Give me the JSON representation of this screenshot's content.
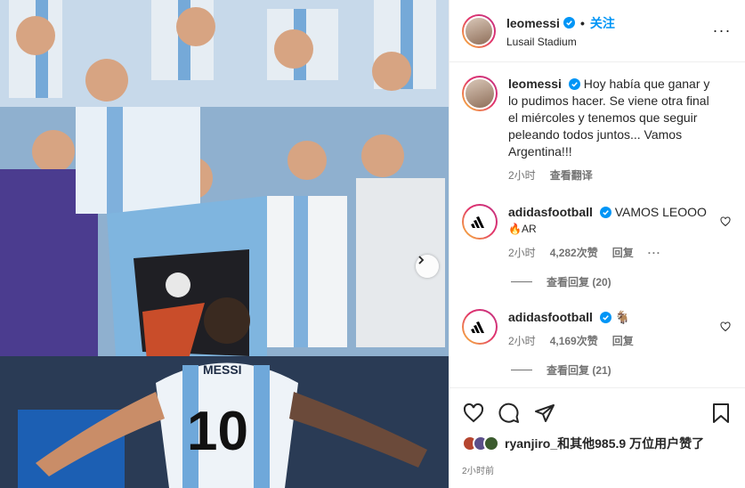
{
  "post": {
    "username": "leomessi",
    "follow_label": "关注",
    "location": "Lusail Stadium",
    "photo_alt_jersey_name": "MESSI",
    "photo_alt_jersey_number": "10"
  },
  "caption": {
    "username": "leomessi",
    "text": "Hoy había que ganar y lo pudimos hacer. Se viene otra final el miércoles y tenemos que seguir peleando todos juntos... Vamos Argentina!!!",
    "time": "2小时",
    "translate_label": "查看翻译"
  },
  "comments": [
    {
      "username": "adidasfootball",
      "text": "VAMOS LEOOO",
      "line2": "🔥AR",
      "time": "2小时",
      "likes": "4,282次赞",
      "reply_label": "回复",
      "more": "···",
      "view_replies": "查看回复 (20)"
    },
    {
      "username": "adidasfootball",
      "text": "🐐",
      "time": "2小时",
      "likes": "4,169次赞",
      "reply_label": "回复",
      "view_replies": "查看回复 (21)"
    }
  ],
  "likes_summary": {
    "liker": "ryanjiro_",
    "text": "和其他985.9 万位用户赞了",
    "time": "2小时前"
  },
  "icons": {
    "header_more": "more-horizontal-icon",
    "like": "heart-icon",
    "comment": "comment-bubble-icon",
    "share": "paper-plane-icon",
    "save": "bookmark-icon",
    "next": "chevron-right-icon"
  },
  "colors": {
    "accent": "#0095f6",
    "verified": "#0095f6",
    "muted": "#737373"
  }
}
